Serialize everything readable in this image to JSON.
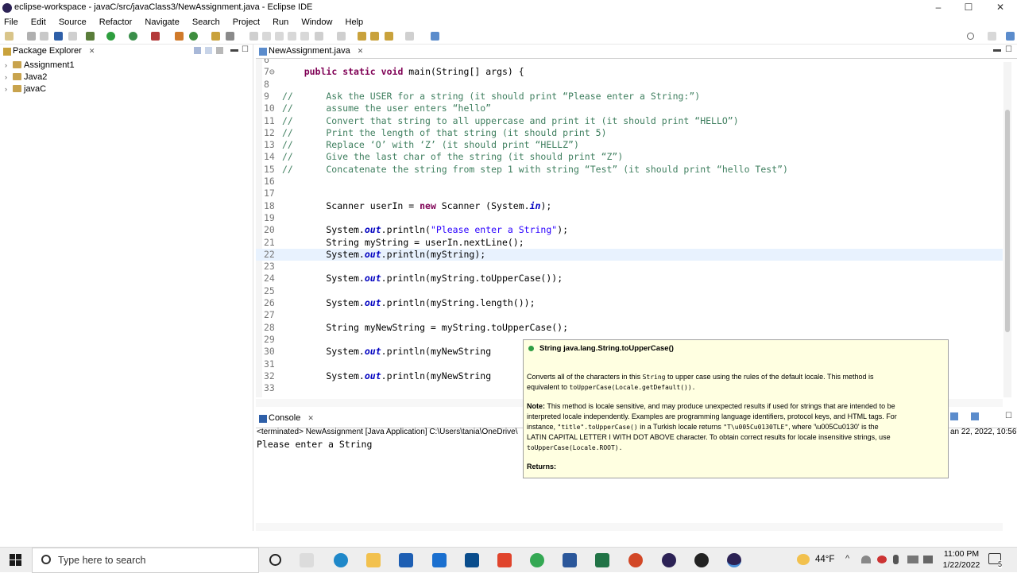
{
  "window": {
    "title": "eclipse-workspace - javaC/src/javaClass3/NewAssignment.java - Eclipse IDE",
    "minimize": "–",
    "maximize": "☐",
    "close": "✕"
  },
  "menu": [
    "File",
    "Edit",
    "Source",
    "Refactor",
    "Navigate",
    "Search",
    "Project",
    "Run",
    "Window",
    "Help"
  ],
  "package_explorer": {
    "tab_label": "Package Explorer",
    "close": "✕",
    "projects": [
      "Assignment1",
      "Java2",
      "javaC"
    ]
  },
  "editor": {
    "tab_label": "NewAssignment.java",
    "close": "✕",
    "lines": [
      {
        "n": "6",
        "code": ""
      },
      {
        "n": "7⊖",
        "code": "    public static void main(String[] args) {"
      },
      {
        "n": "8",
        "code": ""
      },
      {
        "n": "9",
        "code": "//      Ask the USER for a string (it should print “Please enter a String:”)"
      },
      {
        "n": "10",
        "code": "//      assume the user enters “hello”"
      },
      {
        "n": "11",
        "code": "//      Convert that string to all uppercase and print it (it should print “HELLO”)"
      },
      {
        "n": "12",
        "code": "//      Print the length of that string (it should print 5)"
      },
      {
        "n": "13",
        "code": "//      Replace ‘O’ with ‘Z’ (it should print “HELLZ”)"
      },
      {
        "n": "14",
        "code": "//      Give the last char of the string (it should print “Z”)"
      },
      {
        "n": "15",
        "code": "//      Concatenate the string from step 1 with string “Test” (it should print “hello Test”)"
      },
      {
        "n": "16",
        "code": ""
      },
      {
        "n": "17",
        "code": ""
      },
      {
        "n": "18",
        "code": "        Scanner userIn = new Scanner (System.in);"
      },
      {
        "n": "19",
        "code": ""
      },
      {
        "n": "20",
        "code": "        System.out.println(\"Please enter a String\");"
      },
      {
        "n": "21",
        "code": "        String myString = userIn.nextLine();"
      },
      {
        "n": "22",
        "code": "        System.out.println(myString);"
      },
      {
        "n": "23",
        "code": ""
      },
      {
        "n": "24",
        "code": "        System.out.println(myString.toUpperCase());"
      },
      {
        "n": "25",
        "code": ""
      },
      {
        "n": "26",
        "code": "        System.out.println(myString.length());"
      },
      {
        "n": "27",
        "code": ""
      },
      {
        "n": "28",
        "code": "        String myNewString = myString.toUpperCase();"
      },
      {
        "n": "29",
        "code": ""
      },
      {
        "n": "30",
        "code": "        System.out.println(myNewString"
      },
      {
        "n": "31",
        "code": ""
      },
      {
        "n": "32",
        "code": "        System.out.println(myNewString"
      },
      {
        "n": "33",
        "code": ""
      }
    ]
  },
  "console": {
    "tab_label": "Console",
    "close": "✕",
    "status": "<terminated> NewAssignment [Java Application] C:\\Users\\tania\\OneDrive\\",
    "timestamp": "an 22, 2022, 10:56:1",
    "output": "Please enter a String"
  },
  "tooltip": {
    "signature": "String java.lang.String.toUpperCase()",
    "p1_a": "Converts all of the characters in this ",
    "p1_code": "String",
    "p1_b": " to upper case using the rules of the default locale. This method is",
    "p1_c": "equivalent to ",
    "p1_code2": "toUpperCase(Locale.getDefault()).",
    "note_label": "Note:",
    "p2_a": " This method is locale sensitive, and may produce unexpected results if used for strings that are intended to be",
    "p2_b": "interpreted locale independently. Examples are programming language identifiers, protocol keys, and HTML tags. For",
    "p2_c": "instance, ",
    "p2_code1": "\"title\".toUpperCase()",
    "p2_d": " in a Turkish locale returns ",
    "p2_code2": "\"T\\u005Cu0130TLE\"",
    "p2_e": ", where '\\u005Cu0130' is the",
    "p2_f": "LATIN CAPITAL LETTER I WITH DOT ABOVE character. To obtain correct results for locale insensitive strings, use",
    "p2_code3": "toUpperCase(Locale.ROOT).",
    "returns": "Returns:"
  },
  "taskbar": {
    "search_placeholder": "Type here to search",
    "weather": "44°F",
    "time": "11:00 PM",
    "date": "1/22/2022",
    "notification_count": "5"
  },
  "colors": {
    "comment": "#3f7f5f",
    "keyword": "#7f0055",
    "string": "#2a00ff",
    "field": "#0000c0",
    "current_line": "#e8f2fe",
    "tooltip_bg": "#ffffe1"
  }
}
